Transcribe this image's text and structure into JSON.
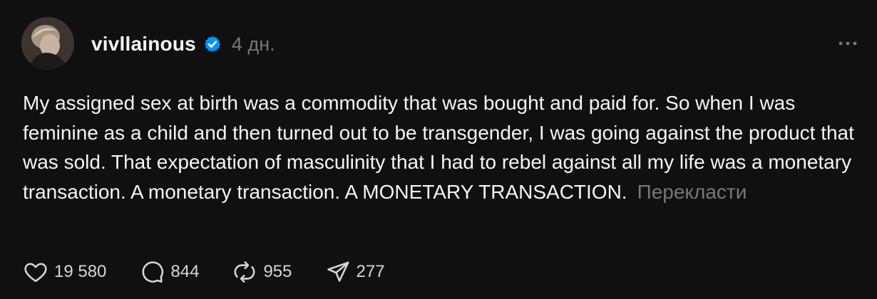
{
  "post": {
    "username": "vivllainous",
    "time": "4 дн.",
    "text": "My assigned sex at birth was a commodity that was bought and paid for. So when I was feminine as a child and then turned out to be transgender, I was going against the product that was sold. That expectation of masculinity that I had to rebel against all my life was a monetary transaction. A monetary transaction. A MONETARY TRANSACTION.",
    "translate_label": "Перекласти"
  },
  "actions": {
    "likes": "19 580",
    "comments": "844",
    "reposts": "955",
    "shares": "277"
  },
  "icons": {
    "verified": "verified-badge-icon",
    "more": "more-options-icon",
    "like": "heart-icon",
    "comment": "comment-bubble-icon",
    "repost": "repost-icon",
    "share": "send-icon"
  },
  "colors": {
    "background": "#101010",
    "text": "#f3f5f7",
    "secondary": "#777777",
    "verified": "#0095f6"
  }
}
